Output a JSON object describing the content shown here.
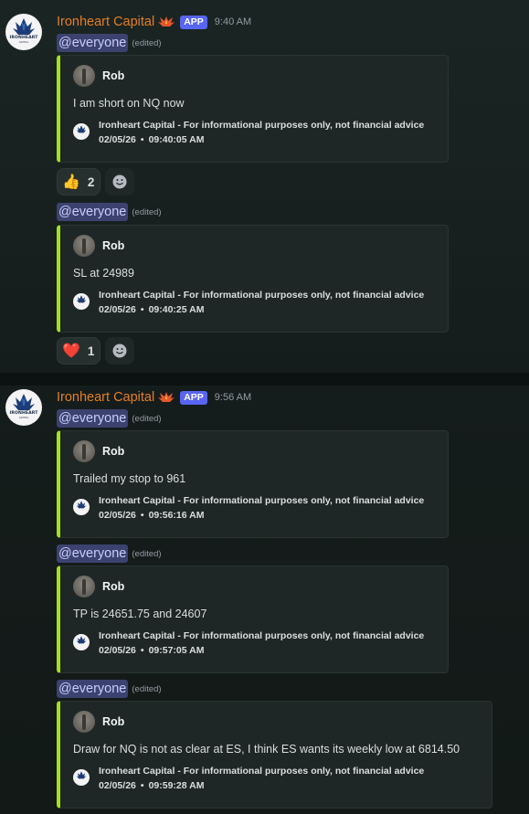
{
  "colors": {
    "accent_bar": "#a4e01f",
    "app_name": "#e67e22",
    "app_tag": "#5865f2",
    "mention_bg": "#3c4270"
  },
  "groups": [
    {
      "avatar_icon": "ironheart-capital-logo",
      "avatar_text": "IRONHEART",
      "avatar_subtext": "CAPITAL",
      "app_name": "Ironheart Capital",
      "role_icon": "phoenix-icon",
      "tag": "APP",
      "time": "9:40 AM",
      "messages": [
        {
          "mention": "@everyone",
          "edited": "(edited)",
          "embed": {
            "author": "Rob",
            "text": "I am short on NQ now",
            "footer": "Ironheart Capital - For informational purposes only, not financial advice",
            "date": "02/05/26",
            "dot": "•",
            "timestamp": "09:40:05 AM"
          },
          "reactions": [
            {
              "emoji": "thumbs-up-icon",
              "glyph": "👍",
              "count": "2"
            }
          ]
        },
        {
          "mention": "@everyone",
          "edited": "(edited)",
          "embed": {
            "author": "Rob",
            "text": "SL at 24989",
            "footer": "Ironheart Capital - For informational purposes only, not financial advice",
            "date": "02/05/26",
            "dot": "•",
            "timestamp": "09:40:25 AM"
          },
          "reactions": [
            {
              "emoji": "heart-icon",
              "glyph": "❤️",
              "count": "1"
            }
          ]
        }
      ]
    },
    {
      "avatar_icon": "ironheart-capital-logo",
      "avatar_text": "IRONHEART",
      "avatar_subtext": "CAPITAL",
      "app_name": "Ironheart Capital",
      "role_icon": "phoenix-icon",
      "tag": "APP",
      "time": "9:56 AM",
      "messages": [
        {
          "mention": "@everyone",
          "edited": "(edited)",
          "embed": {
            "author": "Rob",
            "text": "Trailed my stop to 961",
            "footer": "Ironheart Capital - For informational purposes only, not financial advice",
            "date": "02/05/26",
            "dot": "•",
            "timestamp": "09:56:16 AM"
          }
        },
        {
          "mention": "@everyone",
          "edited": "(edited)",
          "embed": {
            "author": "Rob",
            "text": "TP is 24651.75 and 24607",
            "footer": "Ironheart Capital - For informational purposes only, not financial advice",
            "date": "02/05/26",
            "dot": "•",
            "timestamp": "09:57:05 AM"
          }
        },
        {
          "mention": "@everyone",
          "edited": "(edited)",
          "embed": {
            "author": "Rob",
            "text": "Draw for NQ is not as clear at ES, I think ES wants its weekly low at 6814.50",
            "footer": "Ironheart Capital - For informational purposes only, not financial advice",
            "date": "02/05/26",
            "dot": "•",
            "timestamp": "09:59:28 AM"
          }
        }
      ]
    }
  ]
}
